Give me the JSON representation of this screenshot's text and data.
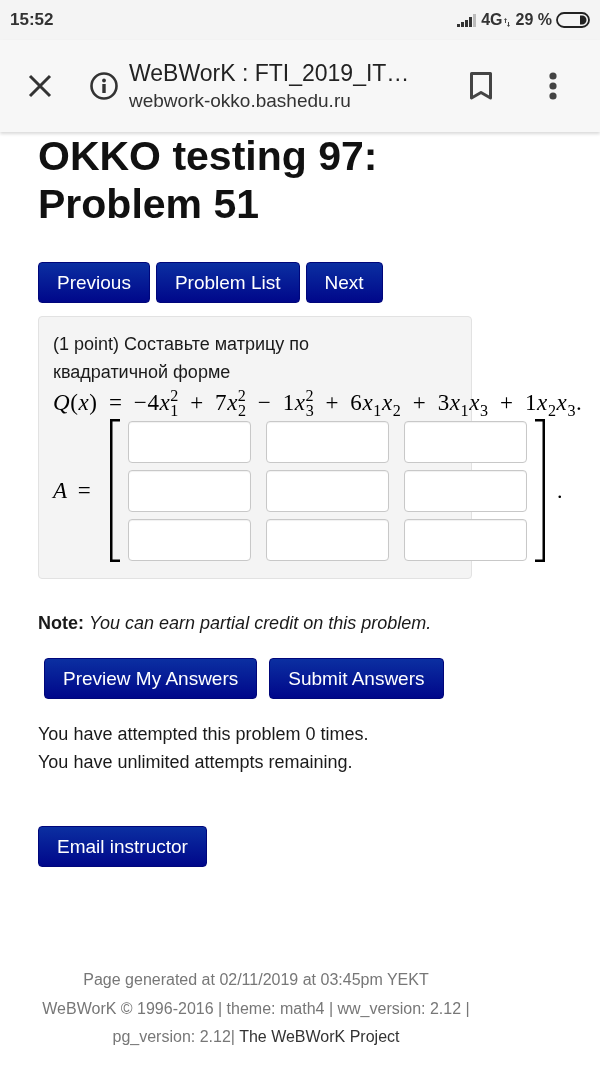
{
  "status_bar": {
    "time": "15:52",
    "network": "4G",
    "battery": "29 %"
  },
  "browser_toolbar": {
    "page_title": "WeBWorK : FTI_2019_IT…",
    "url": "webwork-okko.bashedu.ru"
  },
  "heading": "OKKO testing 97: Problem 51",
  "nav_buttons": [
    "Previous",
    "Problem List",
    "Next"
  ],
  "problem": {
    "prompt": "(1 point) Составьте матрицу по квадратичной форме",
    "formula": "Q(x) = −4x$_{1}$$^{2}$ + 7x$_{2}$$^{2}$ − 1x$_{3}$$^{2}$ + 6x$_{1}$x$_{2}$ + 3x$_{1}$x$_{3}$ + 1x$_{2}$x$_{3}$.",
    "matrix": {
      "label": "A =",
      "rows": [
        {
          "cells": [
            {
              "focused": false
            },
            {
              "focused": false
            },
            {
              "focused": false
            }
          ]
        },
        {
          "cells": [
            {
              "focused": false
            },
            {
              "focused": false
            },
            {
              "focused": false
            }
          ]
        },
        {
          "cells": [
            {
              "focused": false
            },
            {
              "focused": false
            },
            {
              "focused": false
            }
          ]
        }
      ],
      "end_mark": "."
    }
  },
  "note": "**Note:** *You can earn partial credit on this problem.*",
  "answer_buttons": [
    "Preview My Answers",
    "Submit Answers"
  ],
  "attempts": [
    "You have attempted this problem 0 times.",
    "You have unlimited attempts remaining."
  ],
  "email_button": "Email instructor",
  "footer": {
    "generated": "Page generated at 02/11/2019 at 03:45pm YEKT",
    "credits": "WeBWorK © 1996-2016 | theme: math4 | ww_version: 2.12 | pg_version: 2.12|",
    "link": "The WeBWorK Project"
  }
}
